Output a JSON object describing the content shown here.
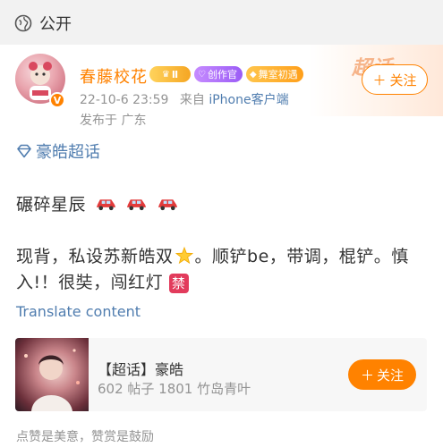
{
  "header": {
    "visibility_label": "公开",
    "visibility_icon": "globe-icon"
  },
  "banner": {
    "text": "超话"
  },
  "author": {
    "name": "春藤校花",
    "verified_badge_text": "V",
    "crown_badge_text": "Ⅱ",
    "creator_badge_text": "创作官",
    "dance_badge_text": "舞室初遇",
    "follow_label": "关注",
    "timestamp": "22-10-6 23:59",
    "source_prefix": "来自",
    "source_device": "iPhone客户端",
    "region": "发布于 广东"
  },
  "post": {
    "topic": "豪皓超话",
    "line1": "碾碎星辰",
    "line2": "现背，私设苏新皓双",
    "line2_after": "。顺铲be，带调，棍铲。慎",
    "line3": "入!！很奘，闯红灯",
    "ban_glyph": "禁",
    "translate_label": "Translate content"
  },
  "topic_card": {
    "title": "【超话】豪皓",
    "stats": "602 帖子 1801 竹岛青叶",
    "follow_label": "关注"
  },
  "footer": {
    "text": "点赞是美意，赞赏是鼓励"
  },
  "colors": {
    "accent_orange": "#ff8200",
    "link_blue": "#507daf",
    "meta_gray": "#939393"
  }
}
